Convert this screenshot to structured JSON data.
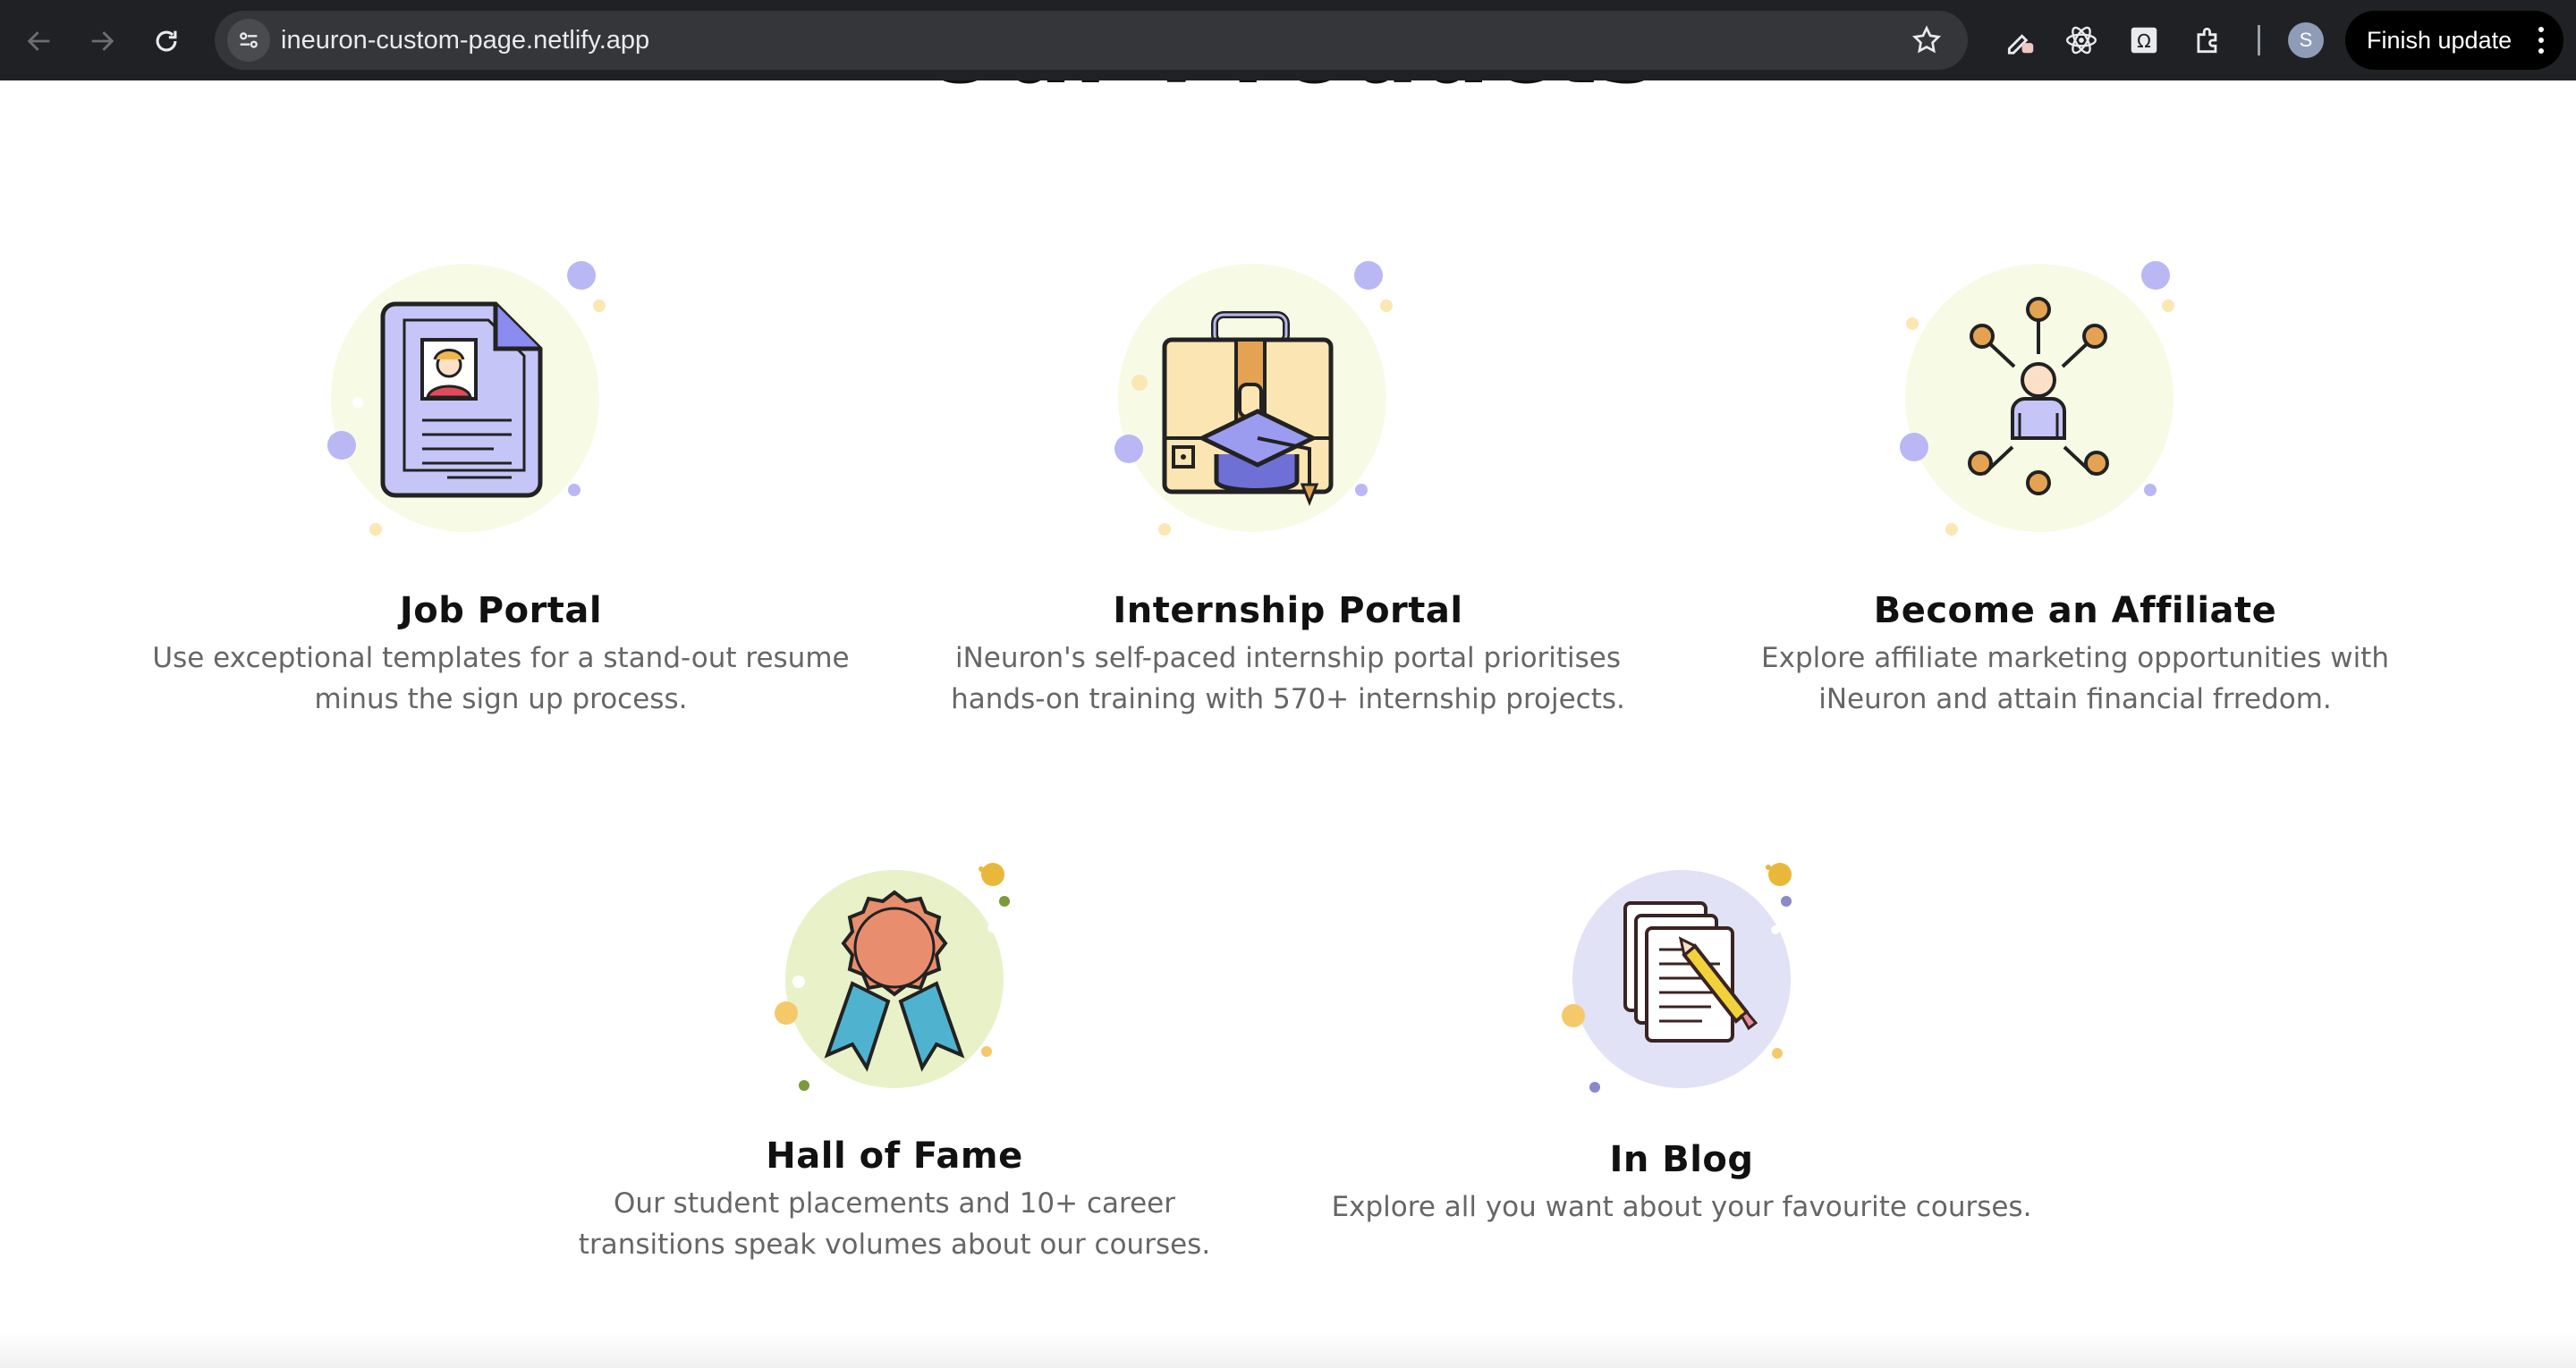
{
  "browser": {
    "url": "ineuron-custom-page.netlify.app",
    "profile_initial": "S",
    "finish_update_label": "Finish update",
    "icons": [
      "back-arrow-icon",
      "forward-arrow-icon",
      "reload-icon",
      "site-info-icon",
      "star-icon",
      "pen-extension-icon",
      "react-devtools-icon",
      "omega-extension-icon",
      "puzzle-extensions-icon",
      "kebab-menu-icon"
    ]
  },
  "page": {
    "section_title": "Our Products",
    "products": [
      {
        "title": "Job Portal",
        "description": "Use exceptional templates for a stand-out resume minus the sign up process.",
        "icon": "resume-document-icon"
      },
      {
        "title": "Internship Portal",
        "description": "iNeuron's self-paced internship portal prioritises hands-on training with 570+ internship projects.",
        "icon": "briefcase-graduation-cap-icon"
      },
      {
        "title": "Become an Affiliate",
        "description": "Explore affiliate marketing opportunities with iNeuron and attain financial frredom.",
        "icon": "affiliate-network-icon"
      },
      {
        "title": "Hall of Fame",
        "description": "Our student placements and 10+ career transitions speak volumes about our courses.",
        "icon": "award-ribbon-icon"
      },
      {
        "title": "In Blog",
        "description": "Explore all you want about your favourite courses.",
        "icon": "blog-papers-pencil-icon"
      }
    ]
  }
}
